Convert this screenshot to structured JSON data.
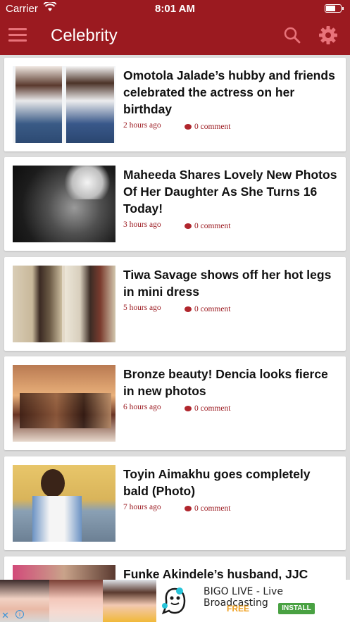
{
  "status_bar": {
    "carrier": "Carrier",
    "time": "8:01 AM",
    "battery_level": 0.7
  },
  "header": {
    "title": "Celebrity",
    "icons": [
      "menu-icon",
      "search-icon",
      "gear-icon"
    ]
  },
  "colors": {
    "brand": "#9b1a20",
    "accent_link": "#9b1a20",
    "install_green": "#49a142",
    "free_orange": "#f0a020"
  },
  "articles": [
    {
      "title": "Omotola Jalade’s hubby and friends celebrated the actress on her birthday",
      "time": "2 hours ago",
      "comments": "0 comment"
    },
    {
      "title": "Maheeda Shares Lovely New Photos Of Her Daughter As She Turns 16 Today!",
      "time": "3 hours ago",
      "comments": "0 comment"
    },
    {
      "title": "Tiwa Savage shows off her hot legs in mini dress",
      "time": "5 hours ago",
      "comments": "0 comment"
    },
    {
      "title": "Bronze beauty! Dencia looks fierce in new photos",
      "time": "6 hours ago",
      "comments": "0 comment"
    },
    {
      "title": "Toyin Aimakhu goes completely bald (Photo)",
      "time": "7 hours ago",
      "comments": "0 comment"
    },
    {
      "title": "Funke Akindele’s husband, JJC",
      "time": "",
      "comments": ""
    }
  ],
  "ad": {
    "title": "BIGO LIVE - Live Broadcasting",
    "price": "FREE",
    "install": "INSTALL",
    "close": "✕",
    "info": "i"
  }
}
